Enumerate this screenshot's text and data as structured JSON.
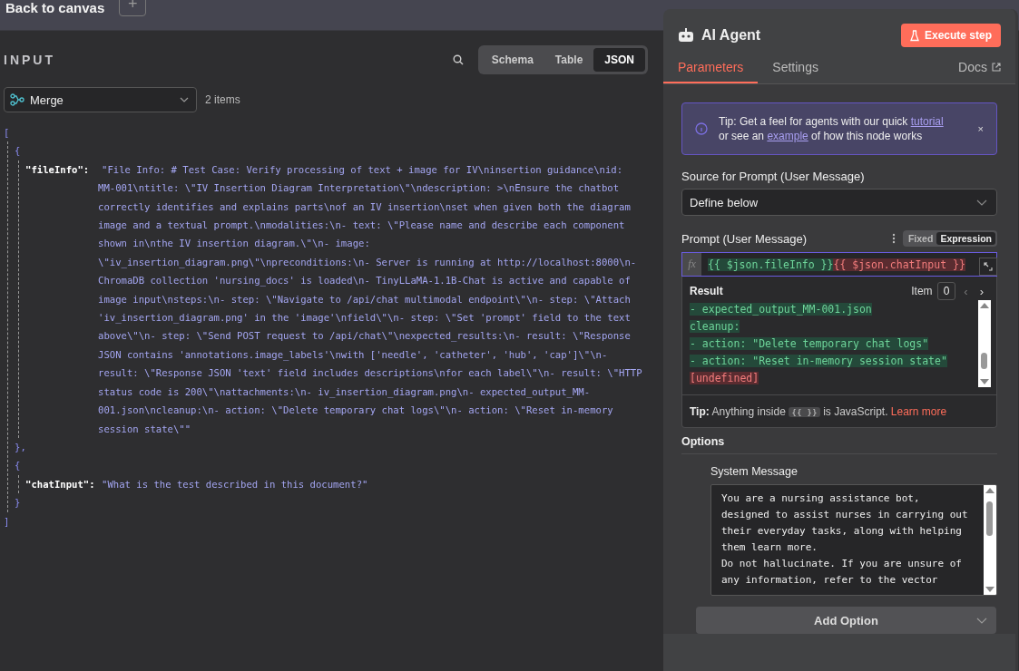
{
  "top_bar": {
    "back_label": "Back to canvas",
    "add_button": "+"
  },
  "input_panel": {
    "title": "INPUT",
    "view_tabs": [
      {
        "label": "Schema",
        "selected": false
      },
      {
        "label": "Table",
        "selected": false
      },
      {
        "label": "JSON",
        "selected": true
      }
    ],
    "source_node": "Merge",
    "item_count": "2 items",
    "json_view": {
      "open_bracket": "[",
      "close_bracket": "]",
      "items": [
        {
          "open": "{",
          "close": "},",
          "key": "\"fileInfo\":",
          "value_lines": [
            "\"File Info: # Test Case: Verify processing of text + image for IV\\ninsertion guidance\\nid:",
            "MM-001\\ntitle: \\\"IV Insertion Diagram Interpretation\\\"\\ndescription: >\\nEnsure the chatbot",
            "correctly identifies and explains parts\\nof an IV insertion\\nset when given both the diagram",
            "image and a textual prompt.\\nmodalities:\\n- text: \\\"Please name and describe each component",
            "shown in\\nthe IV insertion diagram.\\\"\\n- image:",
            "\\\"iv_insertion_diagram.png\\\"\\npreconditions:\\n- Server is running at http://localhost:8000\\n-",
            "ChromaDB collection 'nursing_docs' is loaded\\n- TinyLLaMA-1.1B-Chat is active and capable of",
            "image input\\nsteps:\\n- step: \\\"Navigate to /api/chat multimodal endpoint\\\"\\n- step: \\\"Attach",
            "'iv_insertion_diagram.png' in the 'image'\\nfield\\\"\\n- step: \\\"Set 'prompt' field to the text",
            "above\\\"\\n- step: \\\"Send POST request to /api/chat\\\"\\nexpected_results:\\n- result: \\\"Response",
            "JSON contains 'annotations.image_labels'\\nwith ['needle', 'catheter', 'hub', 'cap']\\\"\\n-",
            "result: \\\"Response JSON 'text' field includes descriptions\\nfor each label\\\"\\n- result: \\\"HTTP",
            "status code is 200\\\"\\nattachments:\\n- iv_insertion_diagram.png\\n- expected_output_MM-",
            "001.json\\ncleanup:\\n- action: \\\"Delete temporary chat logs\\\"\\n- action: \\\"Reset in-memory",
            "session state\\\"\""
          ]
        },
        {
          "open": "{",
          "close": "}",
          "key": "\"chatInput\":",
          "value_lines": [
            "\"What is the test described in this document?\""
          ]
        }
      ]
    }
  },
  "node_panel": {
    "title": "AI Agent",
    "execute_button": "Execute step",
    "tabs": [
      {
        "label": "Parameters",
        "selected": true
      },
      {
        "label": "Settings",
        "selected": false
      }
    ],
    "docs_link": "Docs",
    "tip": {
      "before": "Tip: Get a feel for agents with our quick ",
      "link1": "tutorial",
      "middle": " or see an ",
      "link2": "example",
      "after": " of how this node works",
      "close": "×"
    },
    "source_label": "Source for Prompt (User Message)",
    "source_value": "Define below",
    "prompt_label": "Prompt (User Message)",
    "mode_toggle": [
      {
        "label": "Fixed",
        "selected": false
      },
      {
        "label": "Expression",
        "selected": true
      }
    ],
    "fx_label": "fx",
    "expression": [
      {
        "text": "{{ $json.fileInfo }}",
        "kind": "ok"
      },
      {
        "text": "{{ $json.chatInput }}",
        "kind": "error"
      }
    ],
    "result": {
      "label": "Result",
      "item_label": "Item",
      "item_value": "0",
      "prev": "‹",
      "next": "›",
      "lines": [
        {
          "text": "- expected_output_MM-001.json",
          "kind": "ok"
        },
        {
          "text": "cleanup:",
          "kind": "ok"
        },
        {
          "text": "- action: \"Delete temporary chat logs\"",
          "kind": "ok"
        },
        {
          "text": "- action: \"Reset in-memory session state\"",
          "kind": "ok"
        },
        {
          "text": "[undefined]",
          "kind": "error"
        }
      ]
    },
    "hint": {
      "bold": "Tip:",
      "before": "Anything inside",
      "code": "{{ }}",
      "after": "is JavaScript.",
      "link": "Learn more"
    },
    "options_label": "Options",
    "system_message_label": "System Message",
    "system_message_lines": [
      "You are a nursing assistance bot,",
      "designed to assist nurses in carrying out",
      "their everyday tasks, along with helping",
      "them learn more.",
      "Do not hallucinate. If you are unsure of",
      "any information, refer to the vector"
    ],
    "add_option_button": "Add Option"
  }
}
